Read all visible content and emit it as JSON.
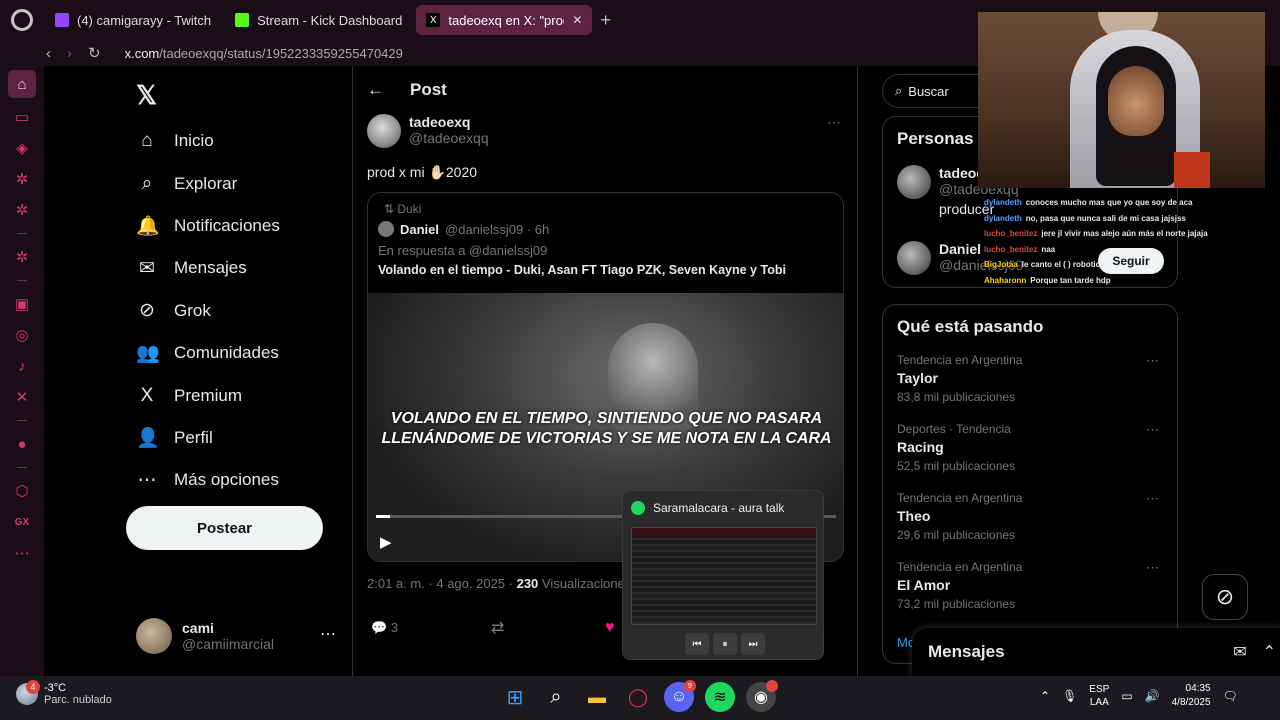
{
  "browser": {
    "tabs": [
      {
        "label": "(4) camigarayy - Twitch",
        "color": "#9146ff",
        "active": false
      },
      {
        "label": "Stream - Kick Dashboard",
        "color": "#53fc18",
        "active": false
      },
      {
        "label": "tadeoexq en X: \"prod x mi",
        "color": "#000000",
        "active": true
      }
    ],
    "url_host": "x.com",
    "url_path": "/tadeoexqq/status/1952233359255470429"
  },
  "x_nav": {
    "items": [
      {
        "label": "Inicio",
        "icon": "⌂"
      },
      {
        "label": "Explorar",
        "icon": "⌕"
      },
      {
        "label": "Notificaciones",
        "icon": "🔔"
      },
      {
        "label": "Mensajes",
        "icon": "✉"
      },
      {
        "label": "Grok",
        "icon": "⊘"
      },
      {
        "label": "Comunidades",
        "icon": "👥"
      },
      {
        "label": "Premium",
        "icon": "X"
      },
      {
        "label": "Perfil",
        "icon": "👤"
      },
      {
        "label": "Más opciones",
        "icon": "⋯"
      }
    ],
    "post_button": "Postear",
    "me_name": "cami",
    "me_handle": "@camiimarcial"
  },
  "post": {
    "header": "Post",
    "author_name": "tadeoexq",
    "author_handle": "@tadeoexqq",
    "text": "prod x mi ✋🏻2020",
    "quote": {
      "retweet_by": "Duki",
      "author_name": "Daniel",
      "author_handle": "@danielssj09 · 6h",
      "reply_to": "En respuesta a @danielssj09",
      "text": "Volando en el tiempo - Duki, Asan FT Tiago PZK, Seven Kayne y Tobi",
      "lyrics_line1": "VOLANDO EN EL TIEMPO, SINTIENDO QUE NO PASARA",
      "lyrics_line2": "LLENÁNDOME DE VICTORIAS Y SE ME NOTA EN LA CARA",
      "progress": 0.03
    },
    "meta_time": "2:01 a. m. · 4 ago. 2025 · ",
    "meta_views_count": "230",
    "meta_views_label": " Visualizaciones",
    "replies": "3"
  },
  "right": {
    "search_placeholder": "Buscar",
    "people_title": "Personas",
    "people": [
      {
        "name": "tadeoexq",
        "handle": "@tadeoexqq",
        "bio": "producer"
      },
      {
        "name": "Daniel",
        "handle": "@danielssj09",
        "bio": ""
      }
    ],
    "follow_label": "Seguir",
    "trends_title": "Qué está pasando",
    "trends": [
      {
        "context": "Tendencia en Argentina",
        "name": "Taylor",
        "count": "83,8 mil publicaciones"
      },
      {
        "context": "Deportes · Tendencia",
        "name": "Racing",
        "count": "52,5 mil publicaciones"
      },
      {
        "context": "Tendencia en Argentina",
        "name": "Theo",
        "count": "29,6 mil publicaciones"
      },
      {
        "context": "Tendencia en Argentina",
        "name": "El Amor",
        "count": "73,2 mil publicaciones"
      }
    ],
    "show_more": "Mo",
    "messages_title": "Mensajes"
  },
  "chat": [
    {
      "user": "dylandeth",
      "color": "#4fa3ff",
      "msg": "conoces mucho mas que yo que soy de aca"
    },
    {
      "user": "dylandeth",
      "color": "#4fa3ff",
      "msg": "no, pasa que nunca sali de mi casa jajsjss"
    },
    {
      "user": "lucho_benitez",
      "color": "#e0443e",
      "msg": "jere jl vivir mas alejo aún más el norte jajaja"
    },
    {
      "user": "lucho_benitez",
      "color": "#e0443e",
      "msg": "naa"
    },
    {
      "user": "BigJotaa",
      "color": "#ffd700",
      "msg": "le canto el ( ) robotics"
    },
    {
      "user": "Ahaharonn",
      "color": "#ffd700",
      "msg": "Porque tan tarde hdp"
    }
  ],
  "spotify": {
    "track": "Saramalacara - aura talk"
  },
  "taskbar": {
    "weather_temp": "-3°C",
    "weather_desc": "Parc. nublado",
    "weather_badge": "4",
    "lang_line1": "ESP",
    "lang_line2": "LAA",
    "time": "04:35",
    "date": "4/8/2025"
  }
}
